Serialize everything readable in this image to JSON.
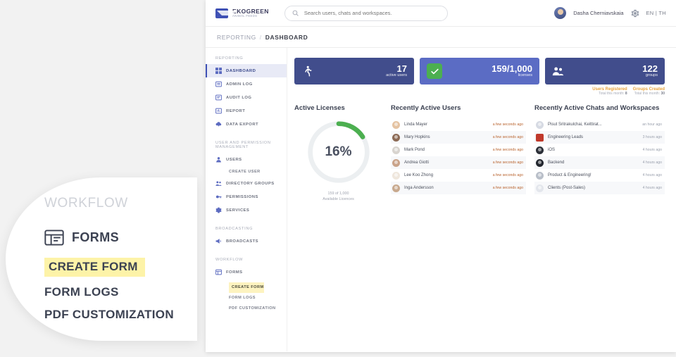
{
  "topbar": {
    "brand_name": "EKOGREEN",
    "brand_sub": "ANIMAL FEEDS",
    "search_placeholder": "Search users, chats and workspaces.",
    "user_name": "Dasha Cherniavskaia",
    "lang": "EN | TH",
    "icons": {
      "search": "search-icon",
      "gear": "gear-icon"
    }
  },
  "breadcrumb": {
    "parent": "REPORTING",
    "separator": "/",
    "current": "DASHBOARD"
  },
  "sidebar": {
    "sections": [
      {
        "label": "REPORTING",
        "items": [
          {
            "label": "DASHBOARD",
            "icon": "grid-icon",
            "active": true
          },
          {
            "label": "ADMIN LOG",
            "icon": "list-icon",
            "active": false
          },
          {
            "label": "AUDIT LOG",
            "icon": "note-icon",
            "active": false
          },
          {
            "label": "REPORT",
            "icon": "chart-icon",
            "active": false
          },
          {
            "label": "DATA EXPORT",
            "icon": "cloud-upload-icon",
            "active": false
          }
        ]
      },
      {
        "label": "USER AND PERMISSION MANAGEMENT",
        "items": [
          {
            "label": "USERS",
            "icon": "user-icon",
            "active": false,
            "sub": [
              "CREATE USER"
            ]
          },
          {
            "label": "DIRECTORY GROUPS",
            "icon": "users-icon",
            "active": false
          },
          {
            "label": "PERMISSIONS",
            "icon": "key-icon",
            "active": false
          },
          {
            "label": "SERVICES",
            "icon": "gear-icon",
            "active": false
          }
        ]
      },
      {
        "label": "BROADCASTING",
        "items": [
          {
            "label": "BROADCASTS",
            "icon": "megaphone-icon",
            "active": false
          }
        ]
      },
      {
        "label": "WORKFLOW",
        "items": [
          {
            "label": "FORMS",
            "icon": "form-icon",
            "active": false,
            "sub": [
              "CREATE FORM",
              "FORM LOGS",
              "PDF CUSTOMIZATION"
            ],
            "sub_highlighted": "CREATE FORM"
          }
        ]
      }
    ]
  },
  "stats": [
    {
      "name": "active-users",
      "value": "17",
      "label": "active users",
      "icon": "person-walking-icon"
    },
    {
      "name": "licenses",
      "value": "159/1,000",
      "label": "licenses",
      "icon": "shield-check-icon"
    },
    {
      "name": "groups",
      "value": "122",
      "label": "groups",
      "icon": "group-icon"
    }
  ],
  "stat_notes": [
    {
      "title": "Users Registered",
      "sub_label": "Total this month:",
      "sub_value": "8"
    },
    {
      "title": "Groups Created",
      "sub_label": "Total this month:",
      "sub_value": "30"
    }
  ],
  "licenses_panel": {
    "title": "Active Licenses",
    "percent": "16%",
    "percent_value": 16,
    "sub_line1": "159 of 1,000",
    "sub_line2": "Available Licences",
    "ring_color": "#4caf50",
    "ring_track": "#eceff1"
  },
  "recent_users": {
    "title": "Recently Active Users",
    "rows": [
      {
        "name": "Linda Mayer",
        "time": "a few seconds ago"
      },
      {
        "name": "Mary Hopkins",
        "time": "a few seconds ago"
      },
      {
        "name": "Mark Pond",
        "time": "a few seconds ago"
      },
      {
        "name": "Andrea Giotti",
        "time": "a few seconds ago"
      },
      {
        "name": "Lee Koo Zhong",
        "time": "a few seconds ago"
      },
      {
        "name": "Inga Andersson",
        "time": "a few seconds ago"
      }
    ]
  },
  "recent_chats": {
    "title": "Recently Active Chats and Workspaces",
    "rows": [
      {
        "name": "Pisut Sritrakulchai, Keittirat...",
        "time": "an hour ago",
        "color": "#d6dae3"
      },
      {
        "name": "Engineering Leads",
        "time": "3 hours ago",
        "color": "#c0392b"
      },
      {
        "name": "iOS",
        "time": "4 hours ago",
        "color": "#2c3038"
      },
      {
        "name": "Backend",
        "time": "4 hours ago",
        "color": "#22262e"
      },
      {
        "name": "Product & Engineering!",
        "time": "4 hours ago",
        "color": "#b9bfc9"
      },
      {
        "name": "Clients (Post-Sales)",
        "time": "4 hours ago",
        "color": "#e3e6ec"
      }
    ]
  },
  "callout": {
    "title": "WORKFLOW",
    "forms_label": "FORMS",
    "create_form": "CREATE FORM",
    "form_logs": "FORM LOGS",
    "pdf_customization": "PDF CUSTOMIZATION",
    "highlight_color": "#fdf3a8"
  }
}
